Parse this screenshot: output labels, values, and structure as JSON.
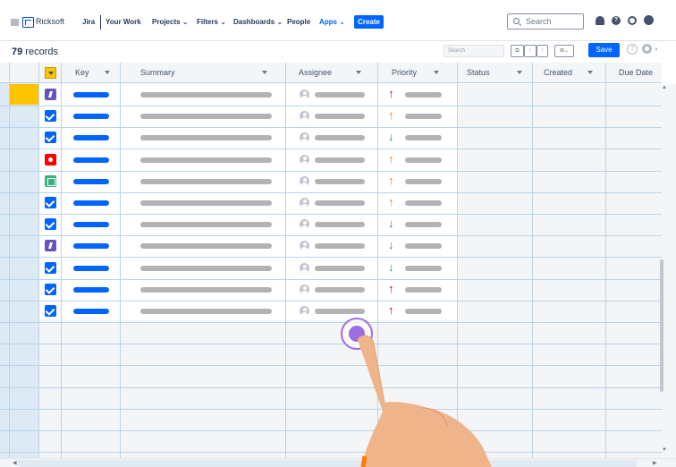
{
  "topnav": {
    "logo_text": "Ricksoft",
    "items": [
      "Jira",
      "Your Work",
      "Projects ⌄",
      "Filters ⌄",
      "Dashboards ⌄",
      "People",
      "Apps ⌄"
    ],
    "create_label": "Create",
    "search_placeholder": "Search"
  },
  "toolbar": {
    "record_count": "79",
    "records_label": " records",
    "search_placeholder": "Search",
    "save_label": "Save",
    "help": "?"
  },
  "columns": [
    "Key",
    "Summary",
    "Assignee",
    "Priority",
    "Status",
    "Created",
    "Due Date"
  ],
  "rows": [
    {
      "type": "epic",
      "priority": "highest"
    },
    {
      "type": "task",
      "priority": "high"
    },
    {
      "type": "task",
      "priority": "low"
    },
    {
      "type": "bug",
      "priority": "high"
    },
    {
      "type": "story",
      "priority": "high"
    },
    {
      "type": "task",
      "priority": "high"
    },
    {
      "type": "task",
      "priority": "low"
    },
    {
      "type": "epic",
      "priority": "low"
    },
    {
      "type": "task",
      "priority": "low"
    },
    {
      "type": "task",
      "priority": "highest"
    },
    {
      "type": "task",
      "priority": "highest"
    }
  ],
  "colors": {
    "accent": "#0065ff",
    "selection": "#ffc400",
    "priority_highest": "#d50000",
    "priority_high": "#ff7a00",
    "priority_low": "#2e9b36"
  }
}
